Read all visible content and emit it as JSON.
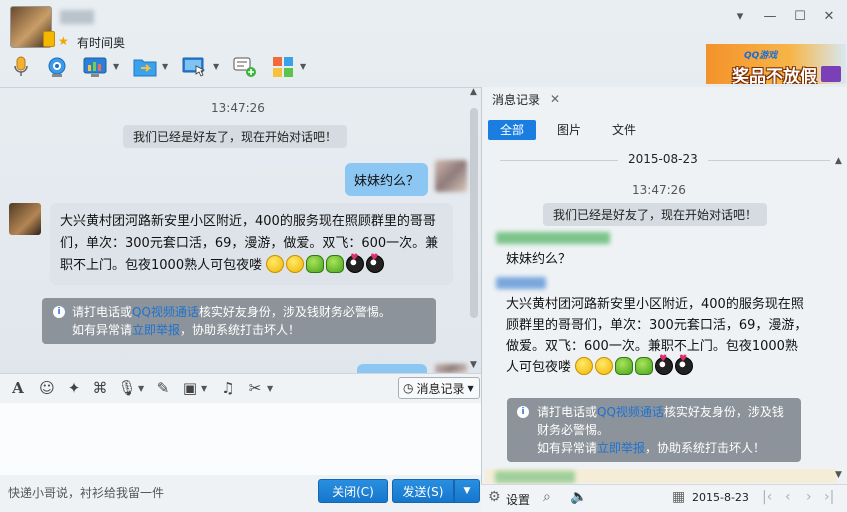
{
  "title_bar": {
    "status_text": "有时间奥",
    "minimize_label": "—",
    "maximize_label": "☐",
    "close_label": "✕",
    "dropdown_label": "▾"
  },
  "ad": {
    "brand": "QQ游戏",
    "slogan": "奖品不放假"
  },
  "chat": {
    "timestamp": "13:47:26",
    "system_msg": "我们已经是好友了，现在开始对话吧！",
    "my_message": "妹妹约么？",
    "their_message": "大兴黄村团河路新安里小区附近，400的服务现在照顾群里的哥哥们，单次：300元套口活，69，漫游，做爱。双飞：600一次。兼职不上门。包夜1000熟人可包夜喽",
    "warning_line1_pre": "请打电话或",
    "warning_link1": "QQ视频通话",
    "warning_line1_post": "核实好友身份，涉及钱财务必警惕。",
    "warning_line2_pre": "如有异常请",
    "warning_link2": "立即举报",
    "warning_line2_post": "，协助系统打击坏人！"
  },
  "input_toolbar": {
    "history_label": "消息记录"
  },
  "bottom": {
    "tip": "快递小哥说，衬衫给我留一件",
    "close_label": "关闭(C)",
    "send_label": "发送(S)"
  },
  "history_panel": {
    "tab_label": "消息记录",
    "tab_close": "✕",
    "filters": [
      "全部",
      "图片",
      "文件"
    ],
    "date": "2015-08-23",
    "timestamp": "13:47:26",
    "system_msg": "我们已经是好友了，现在开始对话吧！",
    "my_message": "妹妹约么？",
    "their_message": "大兴黄村团河路新安里小区附近，400的服务现在照顾群里的哥哥们，单次：300元套口活，69，漫游，做爱。双飞：600一次。兼职不上门。包夜1000熟人可包夜喽",
    "warning_line1_pre": "请打电话或",
    "warning_link1": "QQ视频通话",
    "warning_line1_post": "核实好友身份，涉及钱财务必警惕。",
    "warning_line2_pre": "如有异常请",
    "warning_link2": "立即举报",
    "warning_line2_post": "，协助系统打击坏人！",
    "settings_label": "设置",
    "footer_date": "2015-8-23"
  },
  "colors": {
    "accent": "#1a7ee0",
    "my_bubble": "#8cc6f2",
    "their_bubble": "#dde3e9",
    "warning_bg": "#8c939a"
  }
}
